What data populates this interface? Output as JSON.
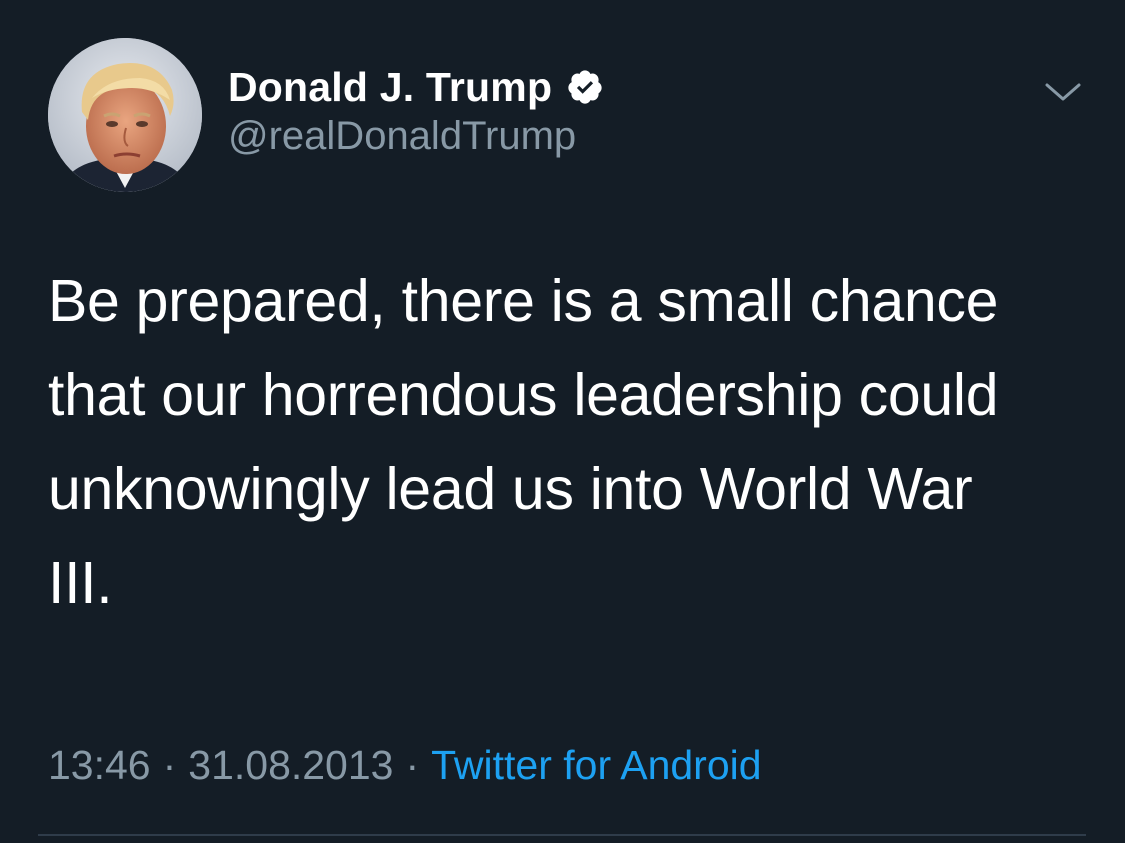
{
  "tweet": {
    "author": {
      "display_name": "Donald J. Trump",
      "handle": "@realDonaldTrump",
      "verified": true
    },
    "text_lines": [
      "Be prepared, there is a small chance",
      "that our horrendous leadership could",
      "unknowingly lead us into World War",
      "III."
    ],
    "time": "13:46",
    "date": "31.08.2013",
    "separator": "·",
    "source": "Twitter for Android"
  },
  "icons": {
    "verified": "verified-badge-icon",
    "menu": "chevron-down-icon"
  },
  "colors": {
    "background": "#141d26",
    "text": "#ffffff",
    "secondary": "#8899a6",
    "link": "#1da1f2"
  }
}
